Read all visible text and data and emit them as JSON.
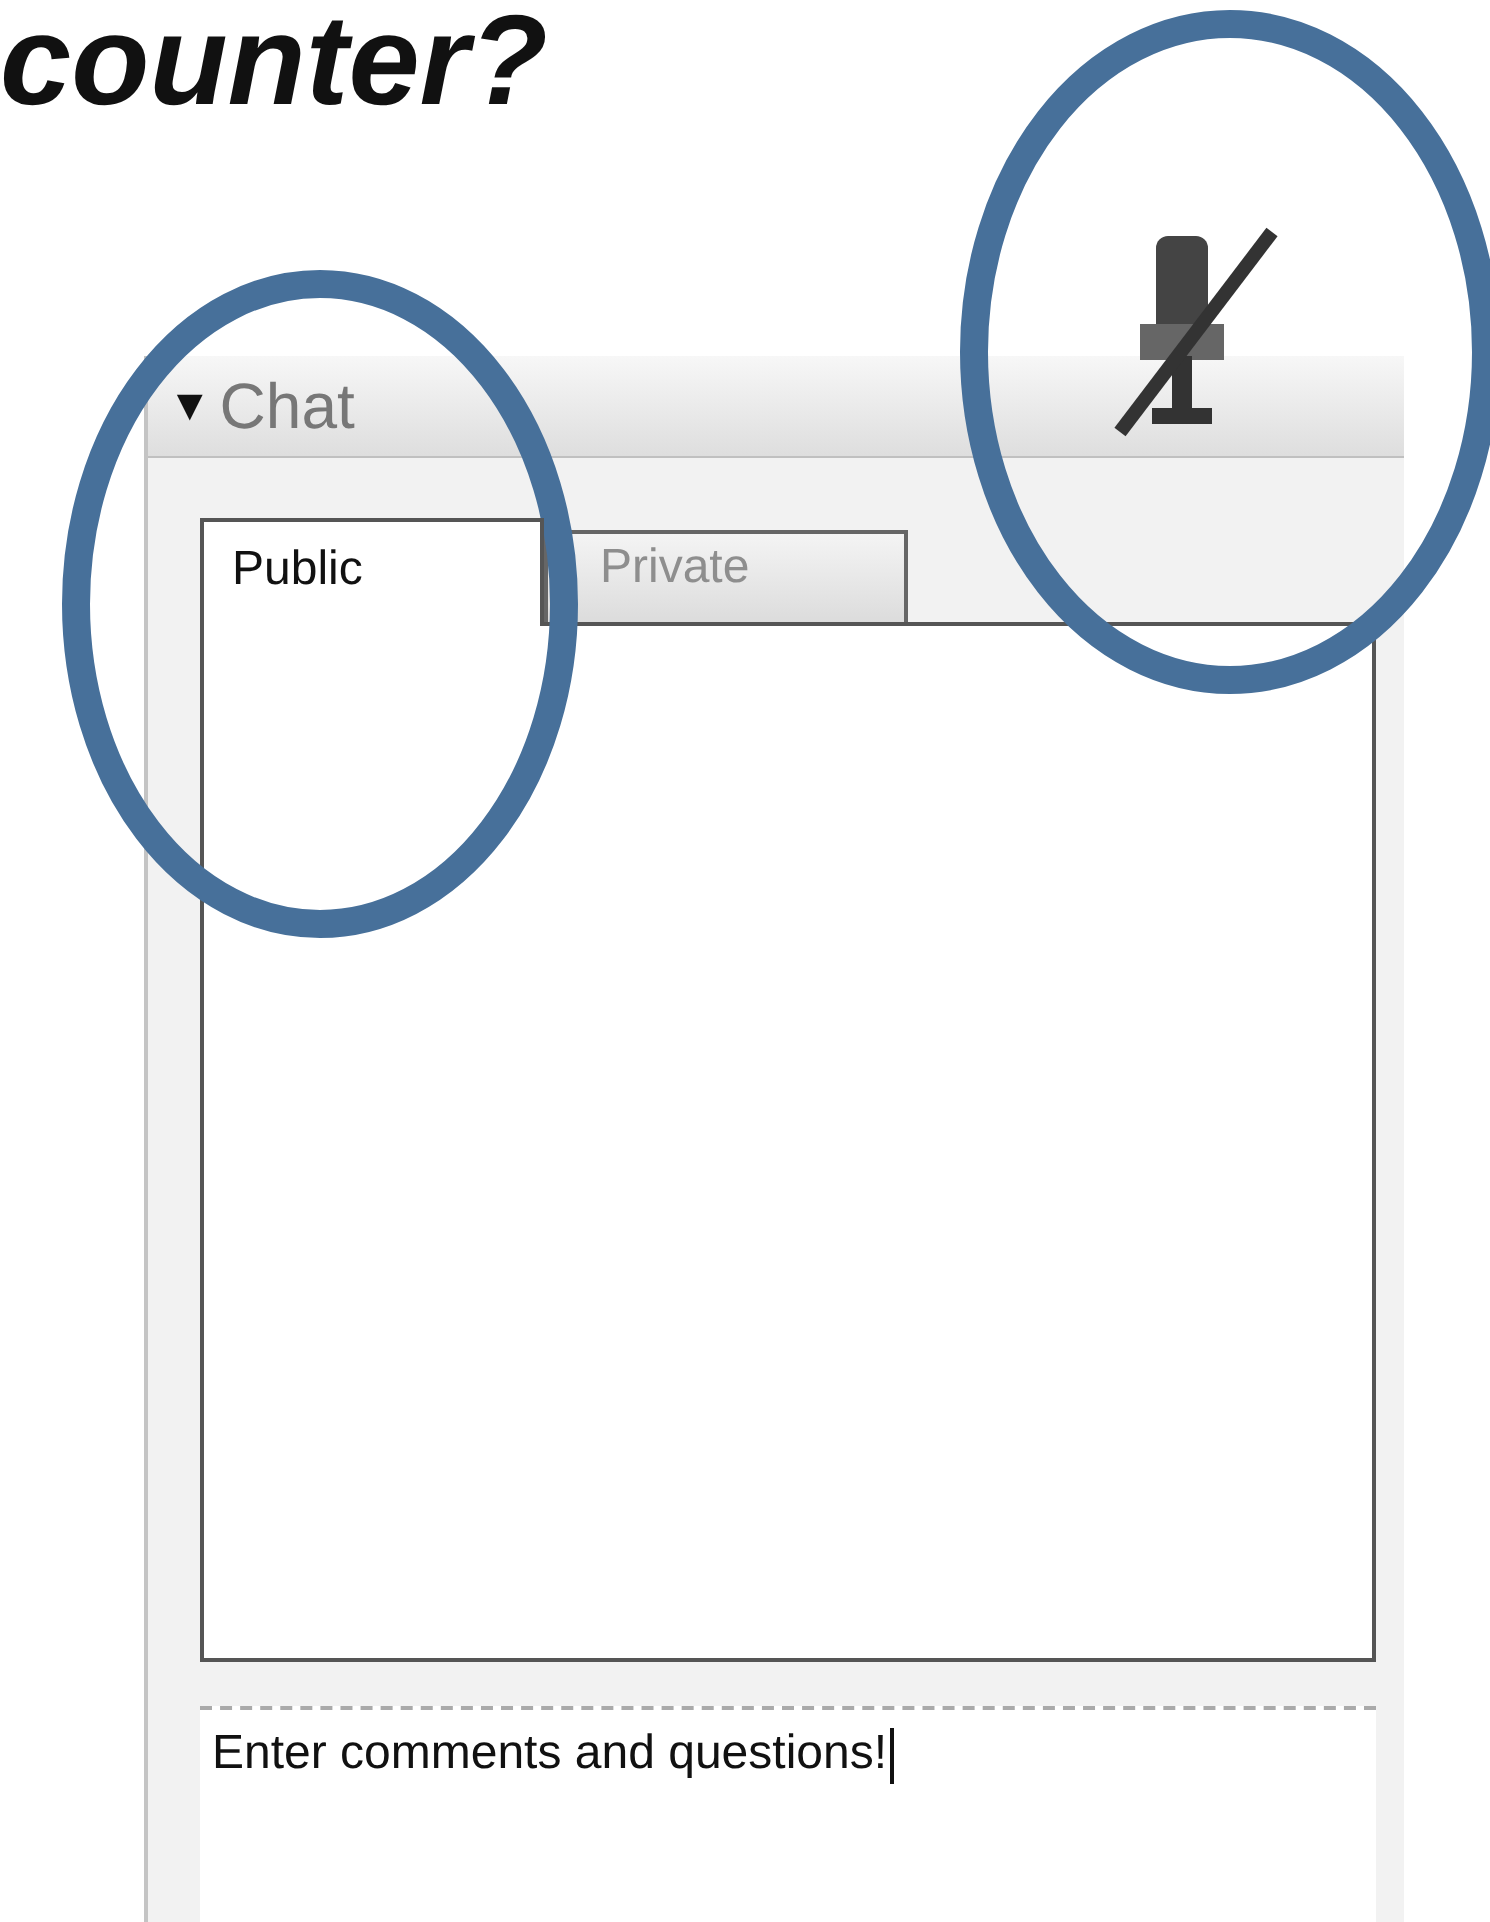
{
  "heading": "counter?",
  "panel": {
    "toggle": "▼",
    "title": "Chat",
    "expanded": true,
    "microphone_muted": true
  },
  "tabs": [
    {
      "label": "Public",
      "selected": true
    },
    {
      "label": "Private",
      "selected": false
    }
  ],
  "message_input": {
    "value": "Enter comments and questions!"
  },
  "annotations": [
    {
      "kind": "circle"
    },
    {
      "kind": "circle"
    }
  ]
}
